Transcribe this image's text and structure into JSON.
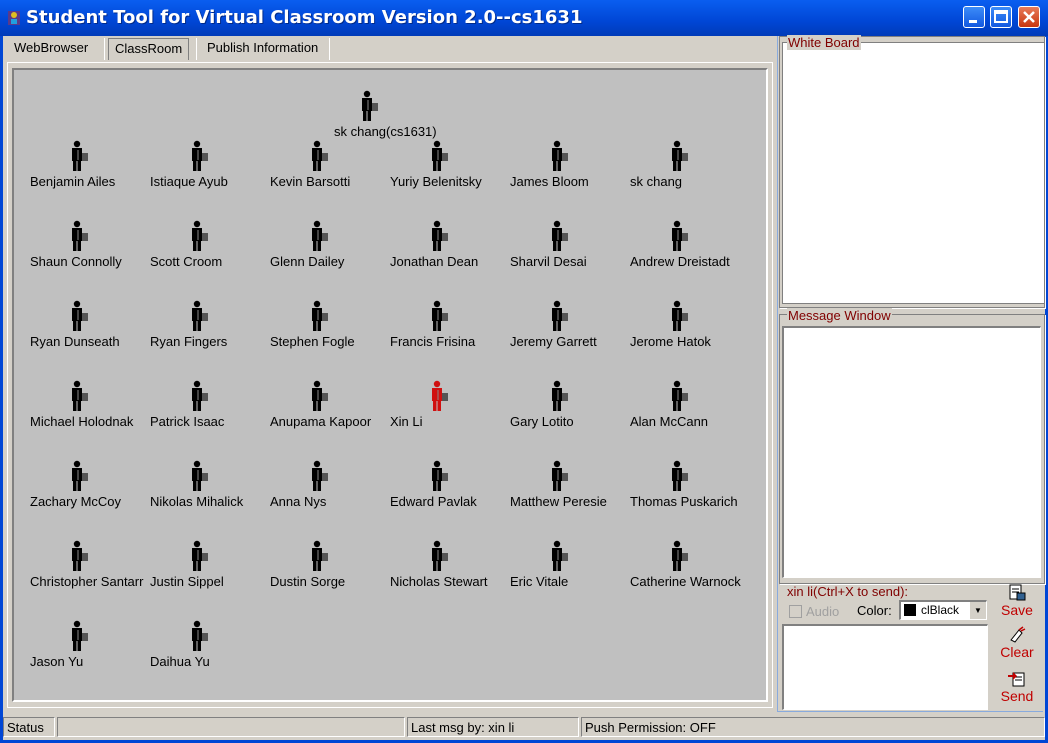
{
  "window": {
    "title": "Student Tool for Virtual Classroom Version 2.0--cs1631"
  },
  "tabs": [
    {
      "label": "WebBrowser"
    },
    {
      "label": "ClassRoom"
    },
    {
      "label": "Publish Information"
    }
  ],
  "classroom": {
    "teacher": {
      "name": "sk chang(cs1631)"
    },
    "students": [
      {
        "name": "Benjamin Ailes",
        "color": "#000000"
      },
      {
        "name": "Istiaque Ayub",
        "color": "#000000"
      },
      {
        "name": "Kevin Barsotti",
        "color": "#000000"
      },
      {
        "name": "Yuriy Belenitsky",
        "color": "#000000"
      },
      {
        "name": "James Bloom",
        "color": "#000000"
      },
      {
        "name": "sk chang",
        "color": "#000000"
      },
      {
        "name": "Shaun Connolly",
        "color": "#000000"
      },
      {
        "name": "Scott Croom",
        "color": "#000000"
      },
      {
        "name": "Glenn Dailey",
        "color": "#000000"
      },
      {
        "name": "Jonathan Dean",
        "color": "#000000"
      },
      {
        "name": "Sharvil Desai",
        "color": "#000000"
      },
      {
        "name": "Andrew Dreistadt",
        "color": "#000000"
      },
      {
        "name": "Ryan Dunseath",
        "color": "#000000"
      },
      {
        "name": "Ryan Fingers",
        "color": "#000000"
      },
      {
        "name": "Stephen Fogle",
        "color": "#000000"
      },
      {
        "name": "Francis Frisina",
        "color": "#000000"
      },
      {
        "name": "Jeremy Garrett",
        "color": "#000000"
      },
      {
        "name": "Jerome Hatok",
        "color": "#000000"
      },
      {
        "name": "Michael Holodnak",
        "color": "#000000"
      },
      {
        "name": "Patrick Isaac",
        "color": "#000000"
      },
      {
        "name": "Anupama Kapoor",
        "color": "#000000"
      },
      {
        "name": "Xin Li",
        "color": "#d01010"
      },
      {
        "name": "Gary Lotito",
        "color": "#000000"
      },
      {
        "name": "Alan McCann",
        "color": "#000000"
      },
      {
        "name": "Zachary McCoy",
        "color": "#000000"
      },
      {
        "name": "Nikolas Mihalick",
        "color": "#000000"
      },
      {
        "name": "Anna Nys",
        "color": "#000000"
      },
      {
        "name": "Edward Pavlak",
        "color": "#000000"
      },
      {
        "name": "Matthew Peresie",
        "color": "#000000"
      },
      {
        "name": "Thomas Puskarich",
        "color": "#000000"
      },
      {
        "name": "Christopher Santarr",
        "color": "#000000"
      },
      {
        "name": "Justin Sippel",
        "color": "#000000"
      },
      {
        "name": "Dustin Sorge",
        "color": "#000000"
      },
      {
        "name": "Nicholas Stewart",
        "color": "#000000"
      },
      {
        "name": "Eric Vitale",
        "color": "#000000"
      },
      {
        "name": "Catherine Warnock",
        "color": "#000000"
      },
      {
        "name": "Jason Yu",
        "color": "#000000"
      },
      {
        "name": "Daihua Yu",
        "color": "#000000"
      }
    ]
  },
  "whiteboard": {
    "label": "White Board"
  },
  "message_window": {
    "label": "Message Window"
  },
  "compose": {
    "send_label": "xin li(Ctrl+X to send):",
    "audio_label": "Audio",
    "color_label": "Color:",
    "color_value": "clBlack",
    "input_value": ""
  },
  "buttons": {
    "save": "Save",
    "clear": "Clear",
    "send": "Send"
  },
  "status": {
    "status": "Status",
    "empty": "",
    "last_msg": "Last msg by: xin li",
    "push": "Push Permission: OFF"
  }
}
